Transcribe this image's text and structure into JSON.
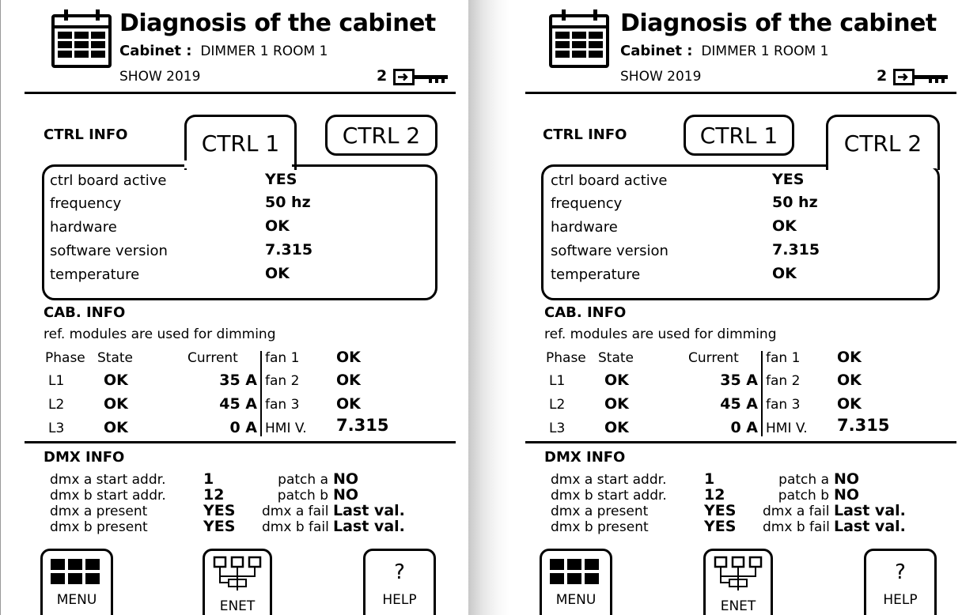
{
  "screens": [
    {
      "header": {
        "title": "Diagnosis of the cabinet",
        "cabinet_label": "Cabinet :",
        "cabinet_value": "DIMMER 1 ROOM 1",
        "show": "SHOW 2019",
        "level": "2"
      },
      "ctrl_info": {
        "section_title": "CTRL INFO",
        "tabs": [
          {
            "label": "CTRL 1",
            "active": true
          },
          {
            "label": "CTRL 2",
            "active": false
          }
        ],
        "rows": [
          {
            "label": "ctrl board active",
            "value": "YES"
          },
          {
            "label": "frequency",
            "value": "50 hz"
          },
          {
            "label": "hardware",
            "value": "OK"
          },
          {
            "label": "software version",
            "value": "7.315"
          },
          {
            "label": "temperature",
            "value": "OK"
          }
        ]
      },
      "cab_info": {
        "section_title": "CAB. INFO",
        "note": "ref. modules are used for dimming",
        "headers": {
          "phase": "Phase",
          "state": "State",
          "current": "Current"
        },
        "phases": [
          {
            "phase": "L1",
            "state": "OK",
            "current": "35 A"
          },
          {
            "phase": "L2",
            "state": "OK",
            "current": "45 A"
          },
          {
            "phase": "L3",
            "state": "OK",
            "current": "0 A"
          }
        ],
        "right": [
          {
            "label": "fan 1",
            "value": "OK"
          },
          {
            "label": "fan 2",
            "value": "OK"
          },
          {
            "label": "fan 3",
            "value": "OK"
          },
          {
            "label": "HMI V.",
            "value": "7.315"
          }
        ]
      },
      "dmx_info": {
        "section_title": "DMX INFO",
        "left": [
          {
            "label": "dmx a start addr.",
            "value": "1"
          },
          {
            "label": "dmx b start addr.",
            "value": "12"
          },
          {
            "label": "dmx a present",
            "value": "YES"
          },
          {
            "label": "dmx b present",
            "value": "YES"
          }
        ],
        "right": [
          {
            "label": "patch a",
            "value": "NO"
          },
          {
            "label": "patch b",
            "value": "NO"
          },
          {
            "label": "dmx a fail",
            "value": "Last val."
          },
          {
            "label": "dmx b fail",
            "value": "Last val."
          }
        ]
      },
      "buttons": {
        "menu": "MENU",
        "enet": "ENET",
        "help": "HELP",
        "help_symbol": "?"
      }
    },
    {
      "header": {
        "title": "Diagnosis of the cabinet",
        "cabinet_label": "Cabinet :",
        "cabinet_value": "DIMMER 1 ROOM 1",
        "show": "SHOW 2019",
        "level": "2"
      },
      "ctrl_info": {
        "section_title": "CTRL INFO",
        "tabs": [
          {
            "label": "CTRL 1",
            "active": false
          },
          {
            "label": "CTRL 2",
            "active": true
          }
        ],
        "rows": [
          {
            "label": "ctrl board active",
            "value": "YES"
          },
          {
            "label": "frequency",
            "value": "50 hz"
          },
          {
            "label": "hardware",
            "value": "OK"
          },
          {
            "label": "software version",
            "value": "7.315"
          },
          {
            "label": "temperature",
            "value": "OK"
          }
        ]
      },
      "cab_info": {
        "section_title": "CAB. INFO",
        "note": "ref. modules are used for dimming",
        "headers": {
          "phase": "Phase",
          "state": "State",
          "current": "Current"
        },
        "phases": [
          {
            "phase": "L1",
            "state": "OK",
            "current": "35 A"
          },
          {
            "phase": "L2",
            "state": "OK",
            "current": "45 A"
          },
          {
            "phase": "L3",
            "state": "OK",
            "current": "0 A"
          }
        ],
        "right": [
          {
            "label": "fan 1",
            "value": "OK"
          },
          {
            "label": "fan 2",
            "value": "OK"
          },
          {
            "label": "fan 3",
            "value": "OK"
          },
          {
            "label": "HMI V.",
            "value": "7.315"
          }
        ]
      },
      "dmx_info": {
        "section_title": "DMX INFO",
        "left": [
          {
            "label": "dmx a start addr.",
            "value": "1"
          },
          {
            "label": "dmx b start addr.",
            "value": "12"
          },
          {
            "label": "dmx a present",
            "value": "YES"
          },
          {
            "label": "dmx b present",
            "value": "YES"
          }
        ],
        "right": [
          {
            "label": "patch a",
            "value": "NO"
          },
          {
            "label": "patch b",
            "value": "NO"
          },
          {
            "label": "dmx a fail",
            "value": "Last val."
          },
          {
            "label": "dmx b fail",
            "value": "Last val."
          }
        ]
      },
      "buttons": {
        "menu": "MENU",
        "enet": "ENET",
        "help": "HELP",
        "help_symbol": "?"
      }
    }
  ]
}
